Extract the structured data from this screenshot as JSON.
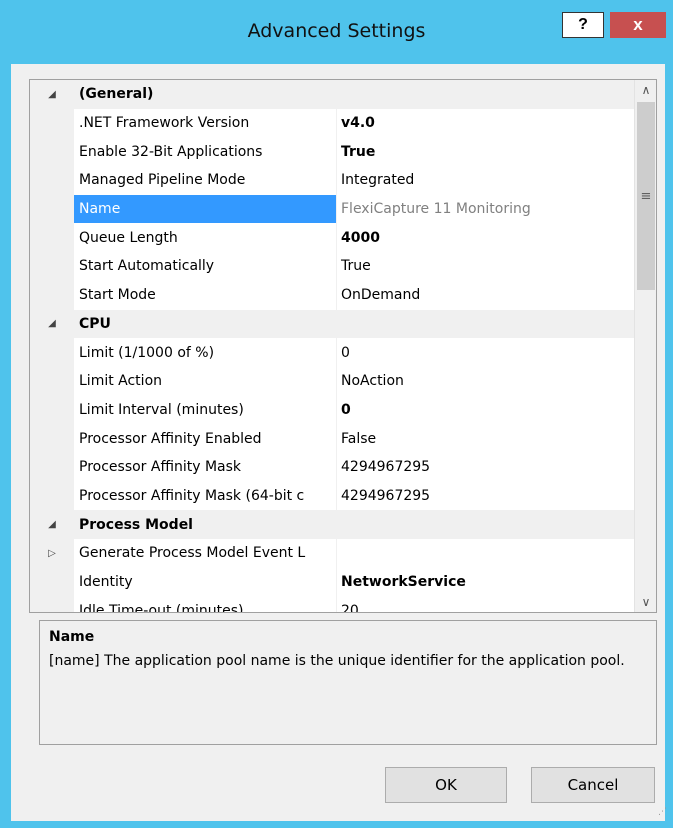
{
  "window": {
    "title": "Advanced Settings",
    "help_label": "?",
    "close_label": "x"
  },
  "grid": {
    "rows": [
      {
        "kind": "category",
        "expander": "◢",
        "name": "(General)",
        "value": ""
      },
      {
        "kind": "property",
        "expander": "",
        "name": ".NET Framework Version",
        "value": "v4.0",
        "style": "bold"
      },
      {
        "kind": "property",
        "expander": "",
        "name": "Enable 32-Bit Applications",
        "value": "True",
        "style": "bold"
      },
      {
        "kind": "property",
        "expander": "",
        "name": "Managed Pipeline Mode",
        "value": "Integrated",
        "style": ""
      },
      {
        "kind": "property",
        "expander": "",
        "name": "Name",
        "value": "FlexiCapture 11 Monitoring",
        "style": "dim",
        "selected": true
      },
      {
        "kind": "property",
        "expander": "",
        "name": "Queue Length",
        "value": "4000",
        "style": "bold"
      },
      {
        "kind": "property",
        "expander": "",
        "name": "Start Automatically",
        "value": "True",
        "style": ""
      },
      {
        "kind": "property",
        "expander": "",
        "name": "Start Mode",
        "value": "OnDemand",
        "style": ""
      },
      {
        "kind": "category",
        "expander": "◢",
        "name": "CPU",
        "value": ""
      },
      {
        "kind": "property",
        "expander": "",
        "name": "Limit (1/1000 of %)",
        "value": "0",
        "style": ""
      },
      {
        "kind": "property",
        "expander": "",
        "name": "Limit Action",
        "value": "NoAction",
        "style": ""
      },
      {
        "kind": "property",
        "expander": "",
        "name": "Limit Interval (minutes)",
        "value": "0",
        "style": "bold"
      },
      {
        "kind": "property",
        "expander": "",
        "name": "Processor Affinity Enabled",
        "value": "False",
        "style": ""
      },
      {
        "kind": "property",
        "expander": "",
        "name": "Processor Affinity Mask",
        "value": "4294967295",
        "style": ""
      },
      {
        "kind": "property",
        "expander": "",
        "name": "Processor Affinity Mask (64-bit c",
        "value": "4294967295",
        "style": ""
      },
      {
        "kind": "category",
        "expander": "◢",
        "name": "Process Model",
        "value": ""
      },
      {
        "kind": "property",
        "expander": "▷",
        "name": "Generate Process Model Event L",
        "value": "",
        "style": ""
      },
      {
        "kind": "property",
        "expander": "",
        "name": "Identity",
        "value": "NetworkService",
        "style": "bold"
      },
      {
        "kind": "property",
        "expander": "",
        "name": "Idle Time-out (minutes)",
        "value": "20",
        "style": ""
      }
    ],
    "scroll_fraction": 0.0
  },
  "description": {
    "title": "Name",
    "text": "[name] The application pool name is the unique identifier for the application pool."
  },
  "buttons": {
    "ok": "OK",
    "cancel": "Cancel"
  },
  "icons": {
    "scroll_up": "chevron-up-icon",
    "scroll_down": "chevron-down-icon",
    "scroll_thumb_grip": "grip-lines-icon"
  }
}
